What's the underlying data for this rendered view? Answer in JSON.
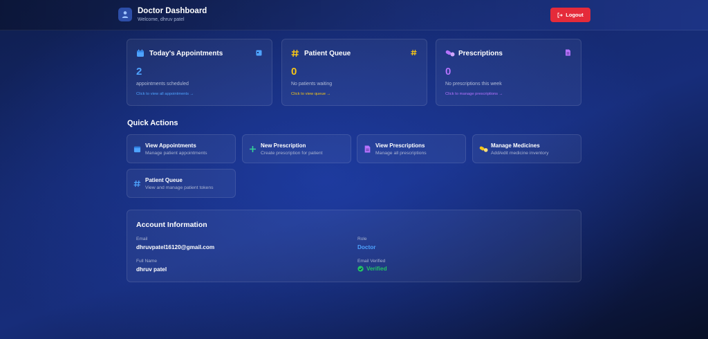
{
  "header": {
    "title": "Doctor Dashboard",
    "subtitle": "Welcome, dhruv patel",
    "logout_label": "Logout"
  },
  "stats": [
    {
      "title": "Today's Appointments",
      "value": "2",
      "description": "appointments scheduled",
      "link": "Click to view all appointments →",
      "color": "#4ea3ff",
      "icon": "calendar-icon"
    },
    {
      "title": "Patient Queue",
      "value": "0",
      "description": "No patients waiting",
      "link": "Click to view queue →",
      "color": "#f5c518",
      "icon": "hash-icon"
    },
    {
      "title": "Prescriptions",
      "value": "0",
      "description": "No prescriptions this week",
      "link": "Click to manage prescriptions →",
      "color": "#b673ff",
      "icon": "pills-icon"
    }
  ],
  "quick_actions": {
    "title": "Quick Actions",
    "items": [
      {
        "title": "View Appointments",
        "subtitle": "Manage patient appointments",
        "icon": "calendar-icon",
        "color": "#4ea3ff"
      },
      {
        "title": "New Prescription",
        "subtitle": "Create prescription for patient",
        "icon": "plus-icon",
        "color": "#34d399"
      },
      {
        "title": "View Prescriptions",
        "subtitle": "Manage all prescriptions",
        "icon": "document-icon",
        "color": "#b673ff"
      },
      {
        "title": "Manage Medicines",
        "subtitle": "Add/edit medicine inventory",
        "icon": "pills-icon",
        "color": "#f5c518"
      },
      {
        "title": "Patient Queue",
        "subtitle": "View and manage patient tokens",
        "icon": "hash-icon",
        "color": "#4ea3ff"
      }
    ]
  },
  "account": {
    "title": "Account Information",
    "email_label": "Email",
    "email": "dhruvpatel16120@gmail.com",
    "role_label": "Role",
    "role": "Doctor",
    "name_label": "Full Name",
    "name": "dhruv patel",
    "verified_label": "Email Verified",
    "verified": "Verified"
  },
  "colors": {
    "accent_blue": "#4ea3ff",
    "accent_yellow": "#f5c518",
    "accent_purple": "#b673ff",
    "accent_green": "#24c466",
    "danger": "#e52b3a"
  }
}
